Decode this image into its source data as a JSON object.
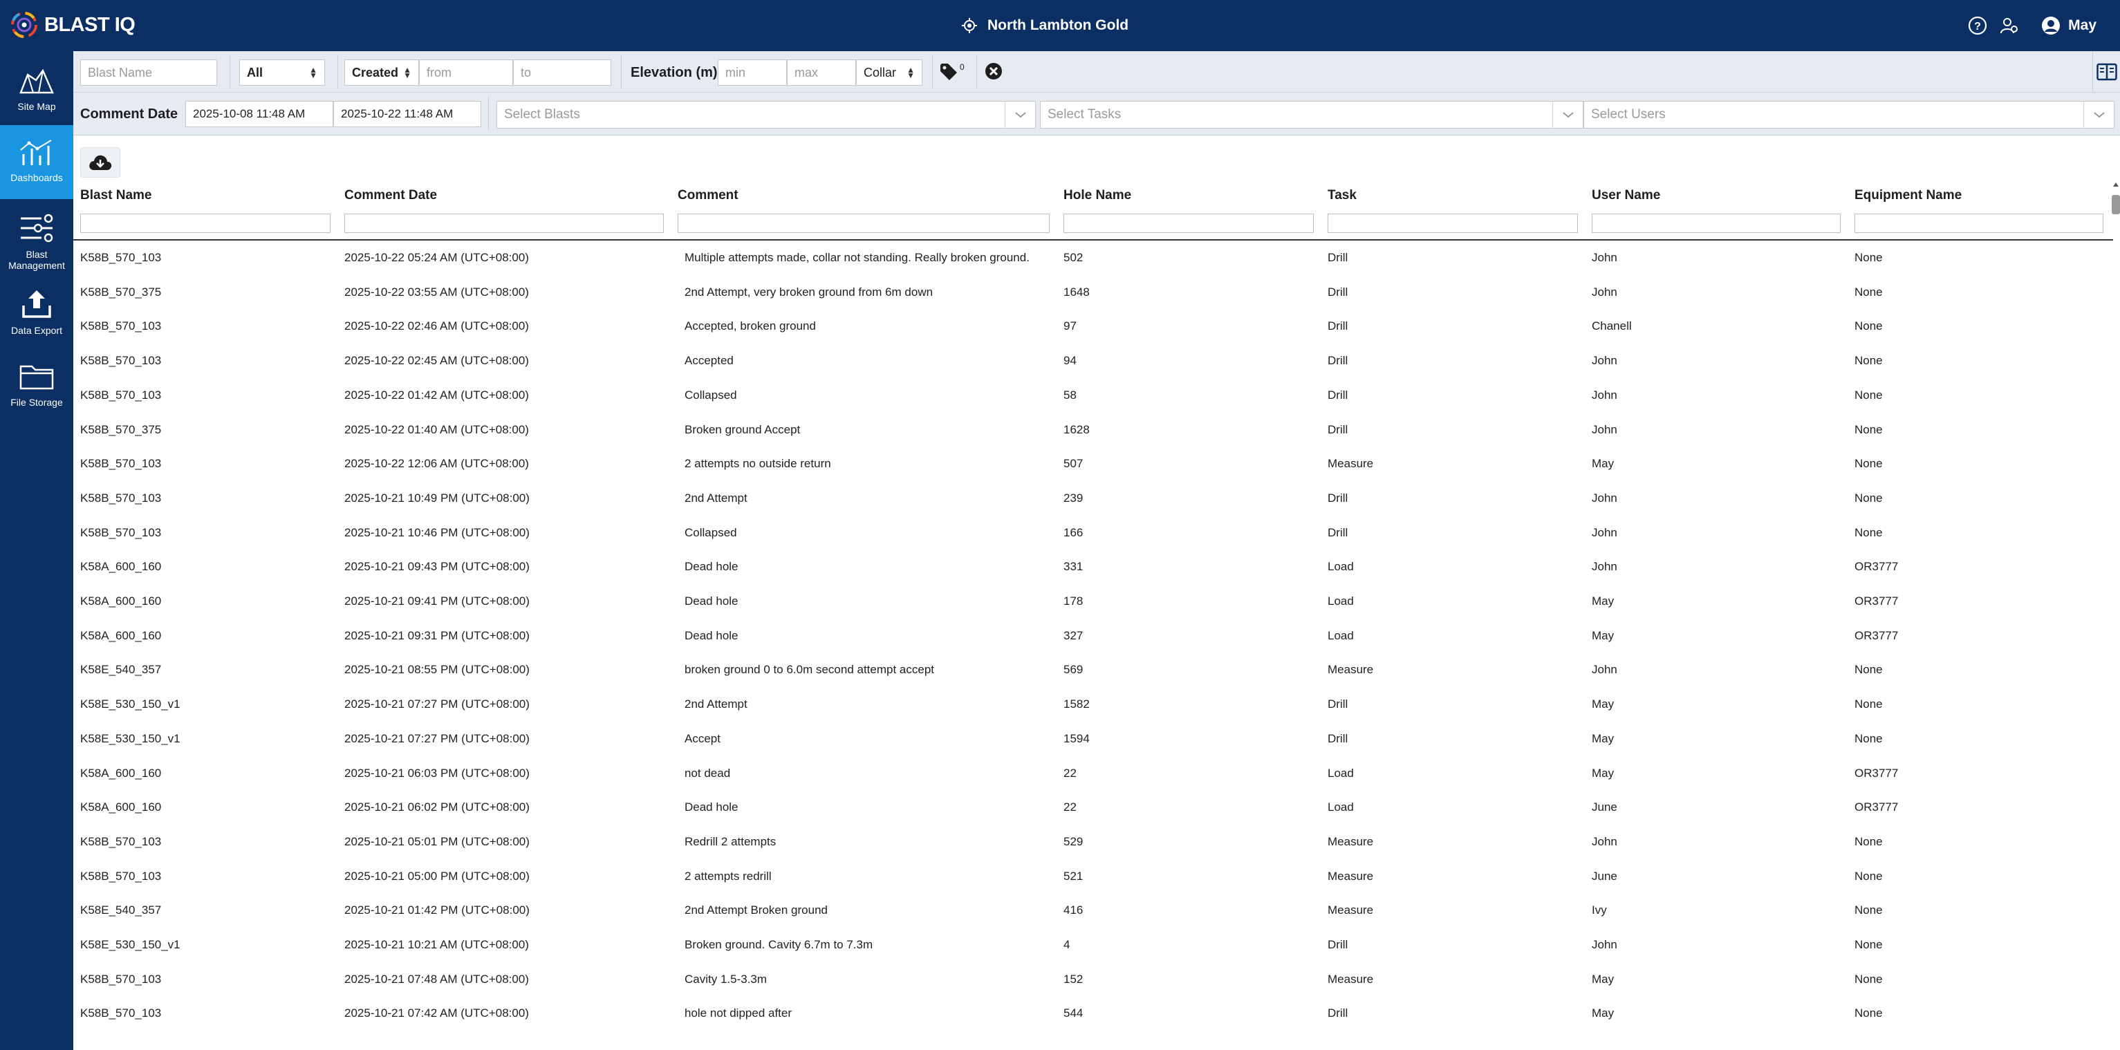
{
  "app": {
    "logo_text": "BLAST IQ",
    "site_name": "North Lambton Gold",
    "user_name": "May",
    "brand_color": "#0b2f63",
    "active_color": "#1a96e0"
  },
  "sidebar": {
    "items": [
      {
        "label": "Site Map",
        "icon": "site-map-icon"
      },
      {
        "label": "Dashboards",
        "icon": "dashboards-icon",
        "active": true
      },
      {
        "label": "Blast Management",
        "icon": "blast-management-icon"
      },
      {
        "label": "Data Export",
        "icon": "data-export-icon"
      },
      {
        "label": "File Storage",
        "icon": "file-storage-icon"
      }
    ]
  },
  "filters": {
    "blast_name_placeholder": "Blast Name",
    "status_value": "All",
    "date_type_value": "Created",
    "from_placeholder": "from",
    "to_placeholder": "to",
    "elevation_label": "Elevation (m)",
    "min_placeholder": "min",
    "max_placeholder": "max",
    "elevation_type_value": "Collar",
    "tag_count": "0"
  },
  "comment_filters": {
    "label": "Comment Date",
    "date_from": "2025-10-08 11:48 AM",
    "date_to": "2025-10-22 11:48 AM",
    "blasts_placeholder": "Select Blasts",
    "tasks_placeholder": "Select Tasks",
    "users_placeholder": "Select Users"
  },
  "table": {
    "columns": [
      "Blast Name",
      "Comment Date",
      "Comment",
      "Hole Name",
      "Task",
      "User Name",
      "Equipment Name"
    ],
    "rows": [
      [
        "K58B_570_103",
        "2025-10-22 05:24 AM (UTC+08:00)",
        "Multiple attempts made, collar not standing. Really broken ground.",
        "502",
        "Drill",
        "John",
        "None"
      ],
      [
        "K58B_570_375",
        "2025-10-22 03:55 AM (UTC+08:00)",
        "2nd Attempt, very broken ground from 6m down",
        "1648",
        "Drill",
        "John",
        "None"
      ],
      [
        "K58B_570_103",
        "2025-10-22 02:46 AM (UTC+08:00)",
        "Accepted, broken ground",
        "97",
        "Drill",
        "Chanell",
        "None"
      ],
      [
        "K58B_570_103",
        "2025-10-22 02:45 AM (UTC+08:00)",
        "Accepted",
        "94",
        "Drill",
        "John",
        "None"
      ],
      [
        "K58B_570_103",
        "2025-10-22 01:42 AM (UTC+08:00)",
        "Collapsed",
        "58",
        "Drill",
        "John",
        "None"
      ],
      [
        "K58B_570_375",
        "2025-10-22 01:40 AM (UTC+08:00)",
        "Broken ground Accept",
        "1628",
        "Drill",
        "John",
        "None"
      ],
      [
        "K58B_570_103",
        "2025-10-22 12:06 AM (UTC+08:00)",
        "2 attempts no outside return",
        "507",
        "Measure",
        "May",
        "None"
      ],
      [
        "K58B_570_103",
        "2025-10-21 10:49 PM (UTC+08:00)",
        "2nd Attempt",
        "239",
        "Drill",
        "John",
        "None"
      ],
      [
        "K58B_570_103",
        "2025-10-21 10:46 PM (UTC+08:00)",
        "Collapsed",
        "166",
        "Drill",
        "John",
        "None"
      ],
      [
        "K58A_600_160",
        "2025-10-21 09:43 PM (UTC+08:00)",
        "Dead hole",
        "331",
        "Load",
        "John",
        "OR3777"
      ],
      [
        "K58A_600_160",
        "2025-10-21 09:41 PM (UTC+08:00)",
        "Dead hole",
        "178",
        "Load",
        "May",
        "OR3777"
      ],
      [
        "K58A_600_160",
        "2025-10-21 09:31 PM (UTC+08:00)",
        "Dead hole",
        "327",
        "Load",
        "May",
        "OR3777"
      ],
      [
        "K58E_540_357",
        "2025-10-21 08:55 PM (UTC+08:00)",
        "broken ground 0 to 6.0m second attempt accept",
        "569",
        "Measure",
        "John",
        "None"
      ],
      [
        "K58E_530_150_v1",
        "2025-10-21 07:27 PM (UTC+08:00)",
        "2nd Attempt",
        "1582",
        "Drill",
        "May",
        "None"
      ],
      [
        "K58E_530_150_v1",
        "2025-10-21 07:27 PM (UTC+08:00)",
        "Accept",
        "1594",
        "Drill",
        "May",
        "None"
      ],
      [
        "K58A_600_160",
        "2025-10-21 06:03 PM (UTC+08:00)",
        "not dead",
        "22",
        "Load",
        "May",
        "OR3777"
      ],
      [
        "K58A_600_160",
        "2025-10-21 06:02 PM (UTC+08:00)",
        "Dead hole",
        "22",
        "Load",
        "June",
        "OR3777"
      ],
      [
        "K58B_570_103",
        "2025-10-21 05:01 PM (UTC+08:00)",
        "Redrill 2 attempts",
        "529",
        "Measure",
        "John",
        "None"
      ],
      [
        "K58B_570_103",
        "2025-10-21 05:00 PM (UTC+08:00)",
        "2 attempts redrill",
        "521",
        "Measure",
        "June",
        "None"
      ],
      [
        "K58E_540_357",
        "2025-10-21 01:42 PM (UTC+08:00)",
        "2nd Attempt Broken ground",
        "416",
        "Measure",
        "Ivy",
        "None"
      ],
      [
        "K58E_530_150_v1",
        "2025-10-21 10:21 AM (UTC+08:00)",
        "Broken ground. Cavity 6.7m to 7.3m",
        "4",
        "Drill",
        "John",
        "None"
      ],
      [
        "K58B_570_103",
        "2025-10-21 07:48 AM (UTC+08:00)",
        "Cavity 1.5-3.3m",
        "152",
        "Measure",
        "May",
        "None"
      ],
      [
        "K58B_570_103",
        "2025-10-21 07:42 AM (UTC+08:00)",
        "hole not dipped after",
        "544",
        "Drill",
        "May",
        "None"
      ]
    ]
  }
}
